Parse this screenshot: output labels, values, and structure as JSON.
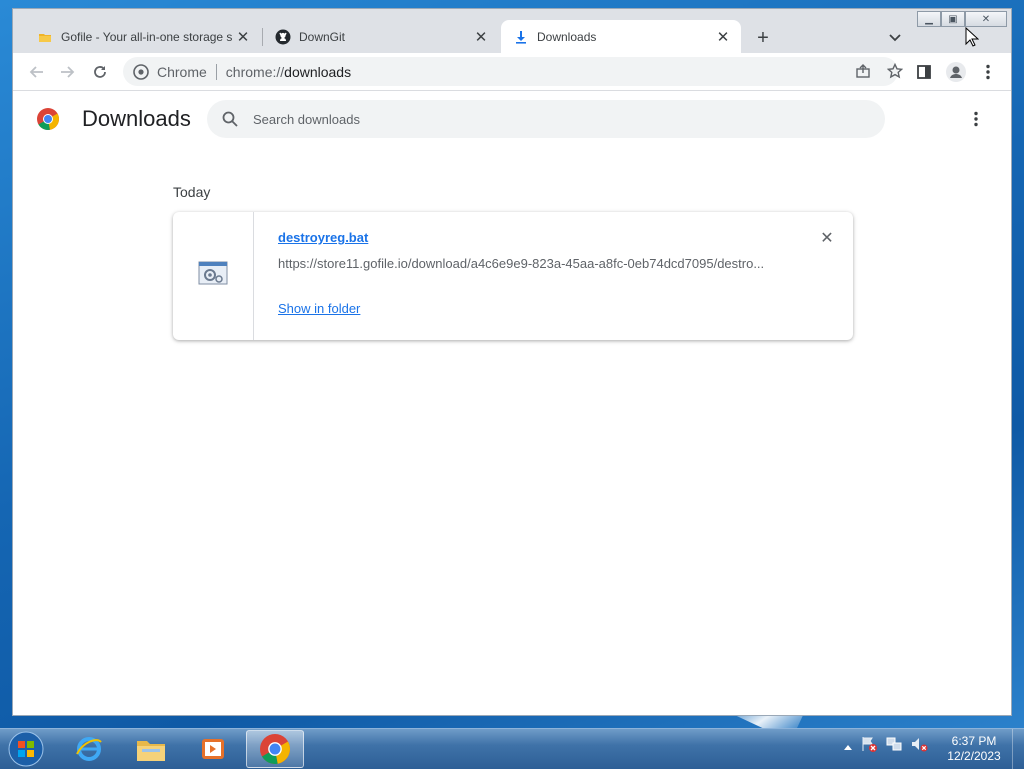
{
  "browser": {
    "tabs": [
      {
        "title": "Gofile - Your all-in-one storage s",
        "icon": "gofile-icon",
        "active": false
      },
      {
        "title": "DownGit",
        "icon": "github-icon",
        "active": false
      },
      {
        "title": "Downloads",
        "icon": "download-icon",
        "active": true
      }
    ],
    "omnibox": {
      "label": "Chrome",
      "url_scheme": "chrome://",
      "url_host": "downloads"
    }
  },
  "downloads": {
    "title": "Downloads",
    "search_placeholder": "Search downloads",
    "section": "Today",
    "item": {
      "filename": "destroyreg.bat",
      "url": "https://store11.gofile.io/download/a4c6e9e9-823a-45aa-a8fc-0eb74dcd7095/destro...",
      "action": "Show in folder"
    }
  },
  "taskbar": {
    "clock_time": "6:37 PM",
    "clock_date": "12/2/2023"
  },
  "colors": {
    "accent": "#1a73e8",
    "tabstrip": "#dee1e6"
  }
}
